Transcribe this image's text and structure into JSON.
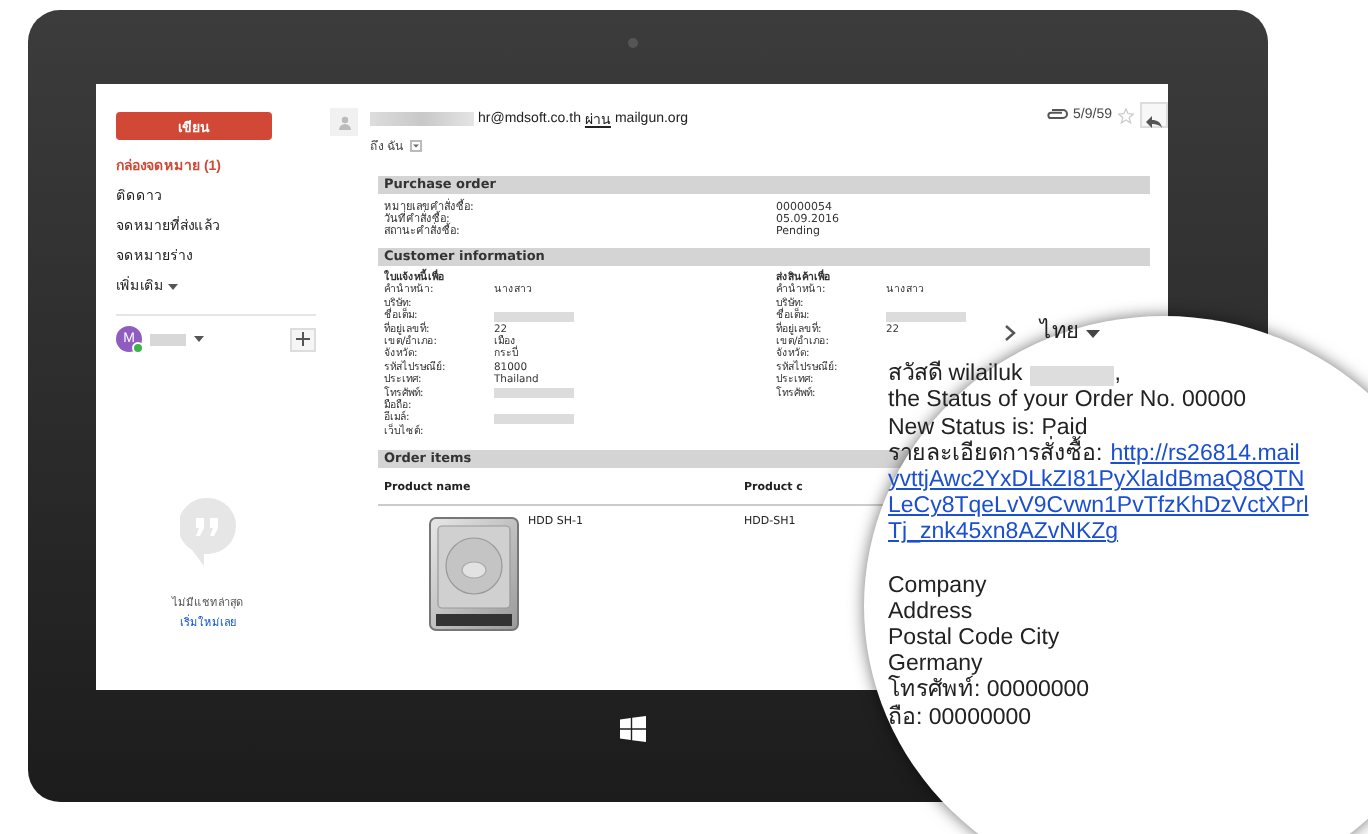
{
  "sidebar": {
    "compose": "เขียน",
    "items": [
      {
        "label": "กล่องจดหมาย (1)",
        "selected": true
      },
      {
        "label": "ติดดาว",
        "selected": false
      },
      {
        "label": "จดหมายที่ส่งแล้ว",
        "selected": false
      },
      {
        "label": "จดหมายร่าง",
        "selected": false
      }
    ],
    "more": "เพิ่มเติม",
    "account": {
      "initial": "M",
      "online": true,
      "name_redacted": true
    },
    "chat": {
      "empty": "ไม่มีแชทล่าสุด",
      "start": "เริ่มใหม่เลย"
    }
  },
  "message": {
    "sender_redacted": true,
    "sender_address": "hr@mdsoft.co.th",
    "via": "ผ่าน",
    "via_domain": "mailgun.org",
    "to": "ถึง ฉัน",
    "date": "5/9/59",
    "has_attachment": true,
    "starred": false
  },
  "email_body": {
    "purchase_order": {
      "title": "Purchase order",
      "rows": [
        {
          "label": "หมายเลขคำสั่งซื้อ:",
          "value": "00000054"
        },
        {
          "label": "วันที่คำสั่งซื้อ:",
          "value": "05.09.2016"
        },
        {
          "label": "สถานะคำสั่งซื้อ:",
          "value": "Pending"
        }
      ]
    },
    "customer_information": {
      "title": "Customer information",
      "columns": [
        {
          "heading": "ใบแจ้งหนี้เพื่อ",
          "rows": [
            {
              "label": "คำนำหน้า:",
              "value": "นางสาว",
              "redacted": false
            },
            {
              "label": "บริษัท:",
              "redacted": false
            },
            {
              "label": "ชื่อเต็ม:",
              "redacted": true
            },
            {
              "label": "ที่อยู่เลขที่:",
              "value": "22",
              "redacted": false
            },
            {
              "label": "เขต/อำเภอ:",
              "value": "เมือง",
              "redacted": false
            },
            {
              "label": "จังหวัด:",
              "value": "กระบี่",
              "redacted": false
            },
            {
              "label": "รหัสไปรษณีย์:",
              "value": "81000",
              "redacted": false
            },
            {
              "label": "ประเทศ:",
              "value": "Thailand",
              "redacted": false
            },
            {
              "label": "โทรศัพท์:",
              "redacted": true
            },
            {
              "label": "มือถือ:",
              "redacted": false
            },
            {
              "label": "อีเมล์:",
              "redacted": true
            },
            {
              "label": "เว็บไซต์:",
              "redacted": false
            }
          ]
        },
        {
          "heading": "ส่งสินค้าเพื่อ",
          "rows": [
            {
              "label": "คำนำหน้า:",
              "value": "นางสาว",
              "redacted": false
            },
            {
              "label": "บริษัท:",
              "redacted": false
            },
            {
              "label": "ชื่อเต็ม:",
              "redacted": true
            },
            {
              "label": "ที่อยู่เลขที่:",
              "value": "22",
              "redacted": false
            },
            {
              "label": "เขต/อำเภอ:",
              "redacted": false
            },
            {
              "label": "จังหวัด:",
              "redacted": false
            },
            {
              "label": "รหัสไปรษณีย์:",
              "redacted": false
            },
            {
              "label": "ประเทศ:",
              "redacted": false
            },
            {
              "label": "โทรศัพท์:",
              "redacted": false
            }
          ]
        }
      ]
    },
    "order_items": {
      "title": "Order items",
      "columns": [
        "Product name",
        "Product c"
      ],
      "rows": [
        {
          "cells": [
            "HDD SH-1",
            "HDD-SH1"
          ]
        }
      ]
    }
  },
  "magnifier": {
    "language": "ไทย",
    "greeting": "สวัสดี wilailuk",
    "name_redacted": true,
    "greeting_end": ",",
    "status_line": "the Status of your Order No. 00000",
    "new_status": "New Status is: Paid",
    "details_label": "รายละเอียดการสั่งซื้อ:",
    "link_lines": [
      "http://rs26814.mail",
      "yvttjAwc2YxDLkZI81PyXlaIdBmaQ8QTN",
      "LeCy8TqeLvV9Cvwn1PvTfzKhDzVctXPrl",
      "Tj_znk45xn8AZvNKZg"
    ],
    "address_lines": [
      "Company",
      "Address",
      "Postal Code  City",
      "Germany",
      "โทรศัพท์: 00000000",
      "ถือ: 00000000"
    ]
  }
}
